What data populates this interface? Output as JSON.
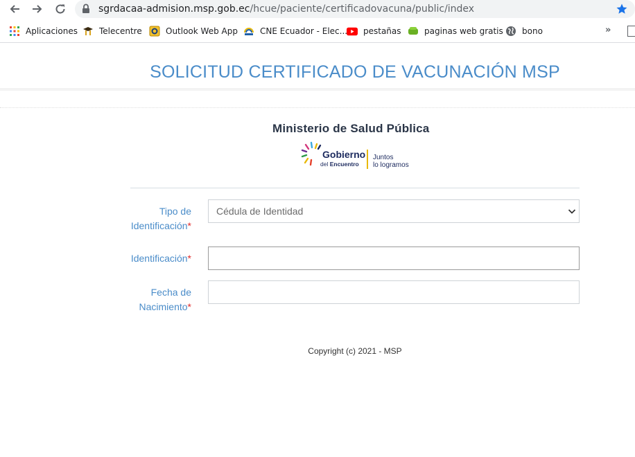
{
  "browser": {
    "url_domain": "sgrdacaa-admision.msp.gob.ec",
    "url_path": "/hcue/paciente/certificadovacuna/public/index",
    "bookmarks": [
      {
        "label": "Aplicaciones",
        "icon": "apps-grid-icon"
      },
      {
        "label": "Telecentre",
        "icon": "telecentre-icon"
      },
      {
        "label": "Outlook Web App",
        "icon": "outlook-icon"
      },
      {
        "label": "CNE Ecuador - Elec...",
        "icon": "cne-icon"
      },
      {
        "label": "pestañas",
        "icon": "youtube-icon"
      },
      {
        "label": "paginas web gratis",
        "icon": "web-icon"
      },
      {
        "label": "bono",
        "icon": "globe-icon"
      }
    ],
    "more_label": "»"
  },
  "page": {
    "title": "SOLICITUD CERTIFICADO DE VACUNACIÓN MSP",
    "ministry": "Ministerio de Salud Pública",
    "logo": {
      "line1": "Gobierno",
      "line2_prefix": "del",
      "line2_bold": "Encuentro",
      "slogan1": "Juntos",
      "slogan2": "lo logramos",
      "accent": "#e8b90a",
      "navy": "#1c2a5e"
    },
    "form": {
      "tipo_label_1": "Tipo de",
      "tipo_label_2": "Identificación",
      "tipo_selected": "Cédula de Identidad",
      "id_label": "Identificación",
      "id_value": "",
      "fecha_label_1": "Fecha de",
      "fecha_label_2": "Nacimiento",
      "fecha_value": "",
      "required_mark": "*"
    },
    "copyright": "Copyright (c) 2021 - MSP"
  },
  "colors": {
    "title_blue": "#4a8cc9",
    "required_red": "#e02b2b",
    "omnibox_bg": "#f1f3f4",
    "star_blue": "#1a73e8"
  }
}
